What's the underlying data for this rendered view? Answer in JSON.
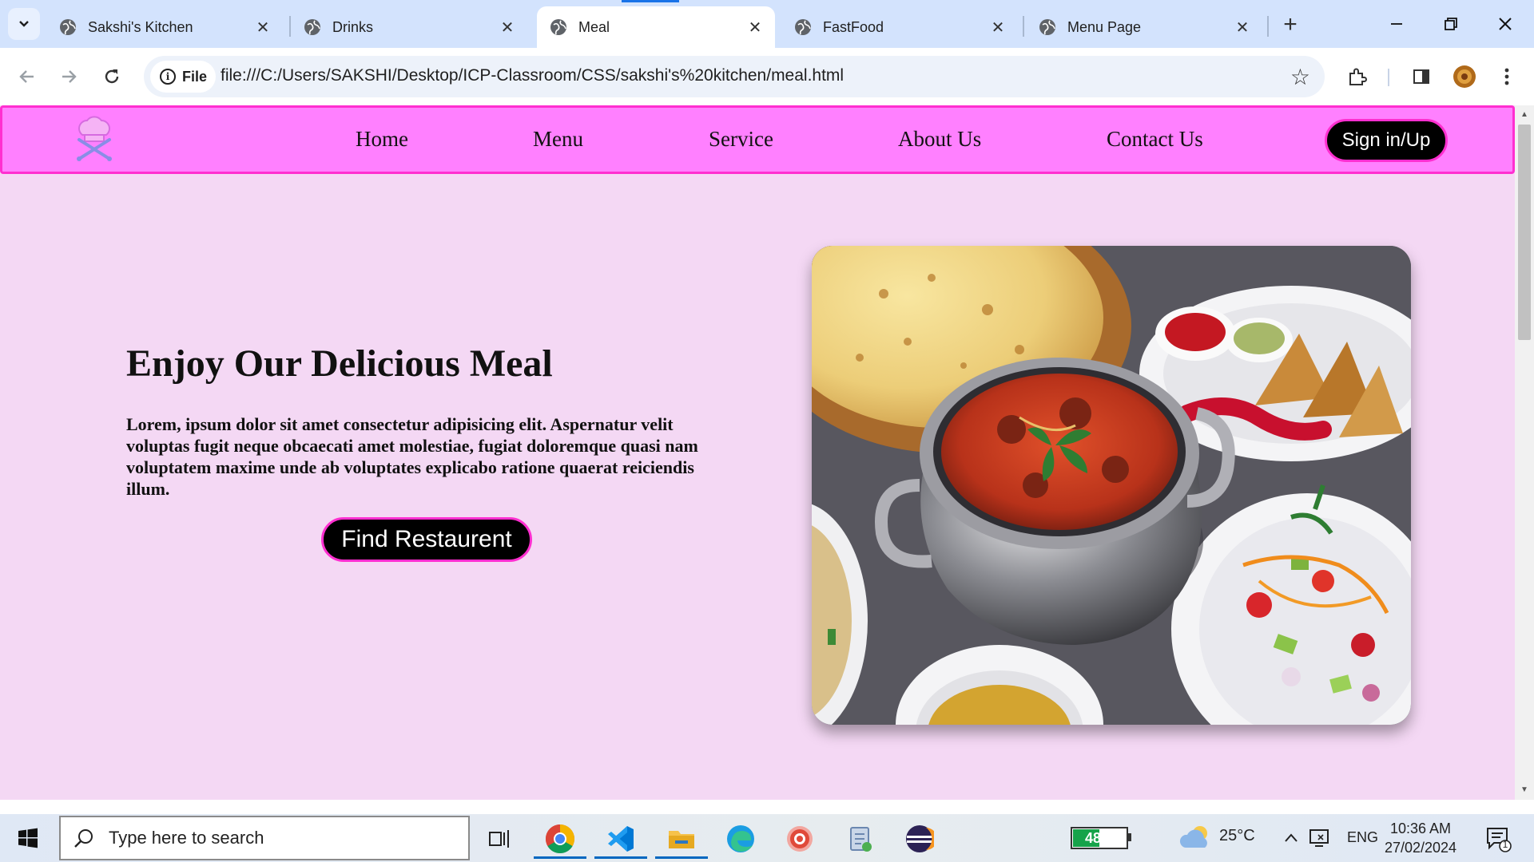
{
  "browser": {
    "tabs": [
      {
        "title": "Sakshi's Kitchen",
        "active": false
      },
      {
        "title": "Drinks",
        "active": false
      },
      {
        "title": "Meal",
        "active": true
      },
      {
        "title": "FastFood",
        "active": false
      },
      {
        "title": "Menu Page",
        "active": false
      }
    ],
    "new_tab_symbol": "+",
    "site_chip": "File",
    "url": "file:///C:/Users/SAKSHI/Desktop/ICP-Classroom/CSS/sakshi's%20kitchen/meal.html"
  },
  "page": {
    "nav": {
      "links": [
        "Home",
        "Menu",
        "Service",
        "About Us",
        "Contact Us"
      ],
      "signin": "Sign in/Up"
    },
    "hero": {
      "title": "Enjoy Our Delicious Meal",
      "text": "Lorem, ipsum dolor sit amet consectetur adipisicing elit. Aspernatur velit voluptas fugit neque obcaecati amet molestiae, fugiat doloremque quasi nam voluptatem maxime unde ab voluptates explicabo ratione quaerat reiciendis illum.",
      "button": "Find Restaurent"
    },
    "colors": {
      "background": "#f4d8f4",
      "navbar": "#ff80ff",
      "accent_border": "#ff2fd0",
      "button": "#000000"
    }
  },
  "taskbar": {
    "search_placeholder": "Type here to search",
    "apps": [
      "task-view-icon",
      "chrome-icon",
      "vscode-icon",
      "file-explorer-icon",
      "edge-icon",
      "screen-recorder-icon",
      "notepad-icon",
      "eclipse-icon"
    ],
    "battery": "48%",
    "battery_level": 0.48,
    "temperature": "25°C",
    "language": "ENG",
    "time": "10:36 AM",
    "date": "27/02/2024",
    "notification_count": "1"
  }
}
